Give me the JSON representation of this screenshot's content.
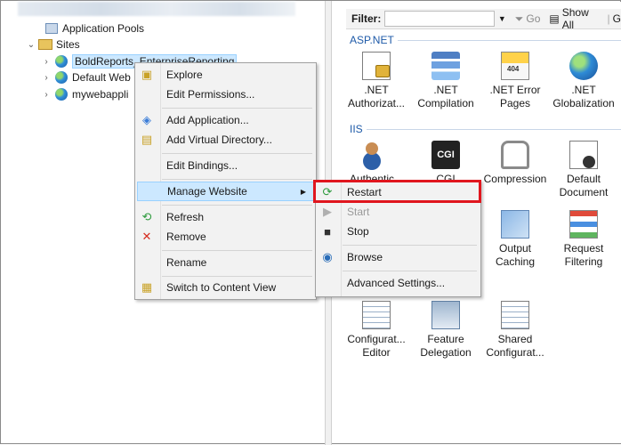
{
  "tree": {
    "items": [
      {
        "label": "Application Pools",
        "icon": "app-pools-icon"
      },
      {
        "label": "Sites",
        "icon": "sites-folder-icon"
      },
      {
        "label": "BoldReports_EnterpriseReporting",
        "icon": "globe-icon"
      },
      {
        "label": "Default Web",
        "icon": "globe-icon"
      },
      {
        "label": "mywebappli",
        "icon": "globe-icon"
      }
    ]
  },
  "filterbar": {
    "filter_label": "Filter:",
    "go_label": "Go",
    "show_all_label": "Show All",
    "cut_label": "G"
  },
  "sections": {
    "aspnet": "ASP.NET",
    "iis": "IIS"
  },
  "features": {
    "net_authorization": ".NET\nAuthorizat...",
    "net_compilation": ".NET\nCompilation",
    "net_error_pages": ".NET Error\nPages",
    "net_globalization": ".NET\nGlobalization",
    "authentication": "Authentic...",
    "cgi": "CGI",
    "compression": "Compression",
    "default_document": "Default\nDocument",
    "output_caching": "Output\nCaching",
    "request_filtering": "Request\nFiltering",
    "configuration_editor": "Configurat...\nEditor",
    "feature_delegation": "Feature\nDelegation",
    "shared_configuration": "Shared\nConfigurat..."
  },
  "context_menu": {
    "explore": "Explore",
    "edit_permissions": "Edit Permissions...",
    "add_application": "Add Application...",
    "add_virtual_directory": "Add Virtual Directory...",
    "edit_bindings": "Edit Bindings...",
    "manage_website": "Manage Website",
    "refresh": "Refresh",
    "remove": "Remove",
    "rename": "Rename",
    "switch_to_content_view": "Switch to Content View"
  },
  "submenu": {
    "restart": "Restart",
    "start": "Start",
    "stop": "Stop",
    "browse": "Browse",
    "advanced_settings": "Advanced Settings..."
  },
  "colors": {
    "highlight": "#cce8ff",
    "highlight_border": "#99d1ff",
    "annotation_red": "#e0161e",
    "section_blue": "#1e5aa8"
  }
}
